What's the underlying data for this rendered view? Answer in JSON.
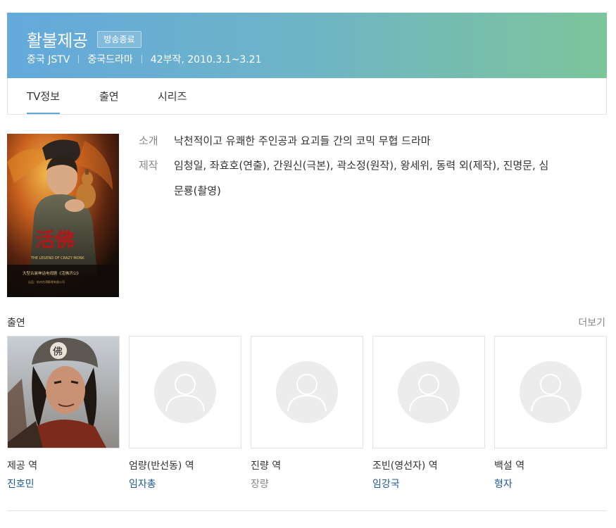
{
  "header": {
    "title": "활불제공",
    "badge": "방송종료",
    "channel": "중국 JSTV",
    "genre": "중국드라마",
    "episodes": "42부작, 2010.3.1~3.21",
    "gradient_start": "#63a9dc",
    "gradient_end": "#7cc59a"
  },
  "tabs": [
    {
      "label": "TV정보",
      "active": true
    },
    {
      "label": "출연",
      "active": false
    },
    {
      "label": "시리즈",
      "active": false
    }
  ],
  "poster": {
    "title_text": "活佛濟公",
    "subtitle": "THE LEGEND OF CRAZY MONK",
    "caption": "大型古装神话电视剧《活佛济公》"
  },
  "info": {
    "intro_label": "소개",
    "intro_value": "낙천적이고 유쾌한 주인공과 요괴들 간의 코믹 무협 드라마",
    "production_label": "제작",
    "production_value": "임청일, 좌효호(연출), 간원신(극본), 곽소정(원작), 왕세위, 동력 외(제작), 진명문, 심문룡(촬영)"
  },
  "cast": {
    "title": "출연",
    "more": "더보기",
    "members": [
      {
        "role": "제공 역",
        "actor": "진호민",
        "linked": true,
        "has_photo": true
      },
      {
        "role": "엄량(반선동) 역",
        "actor": "임자총",
        "linked": true,
        "has_photo": false
      },
      {
        "role": "진량 역",
        "actor": "장량",
        "linked": false,
        "has_photo": false
      },
      {
        "role": "조빈(영선자) 역",
        "actor": "임강국",
        "linked": true,
        "has_photo": false
      },
      {
        "role": "백설 역",
        "actor": "형자",
        "linked": true,
        "has_photo": false
      }
    ]
  },
  "colors": {
    "link": "#1d5a99",
    "tab_active": "#5aa6d6",
    "placeholder": "#ececec"
  }
}
